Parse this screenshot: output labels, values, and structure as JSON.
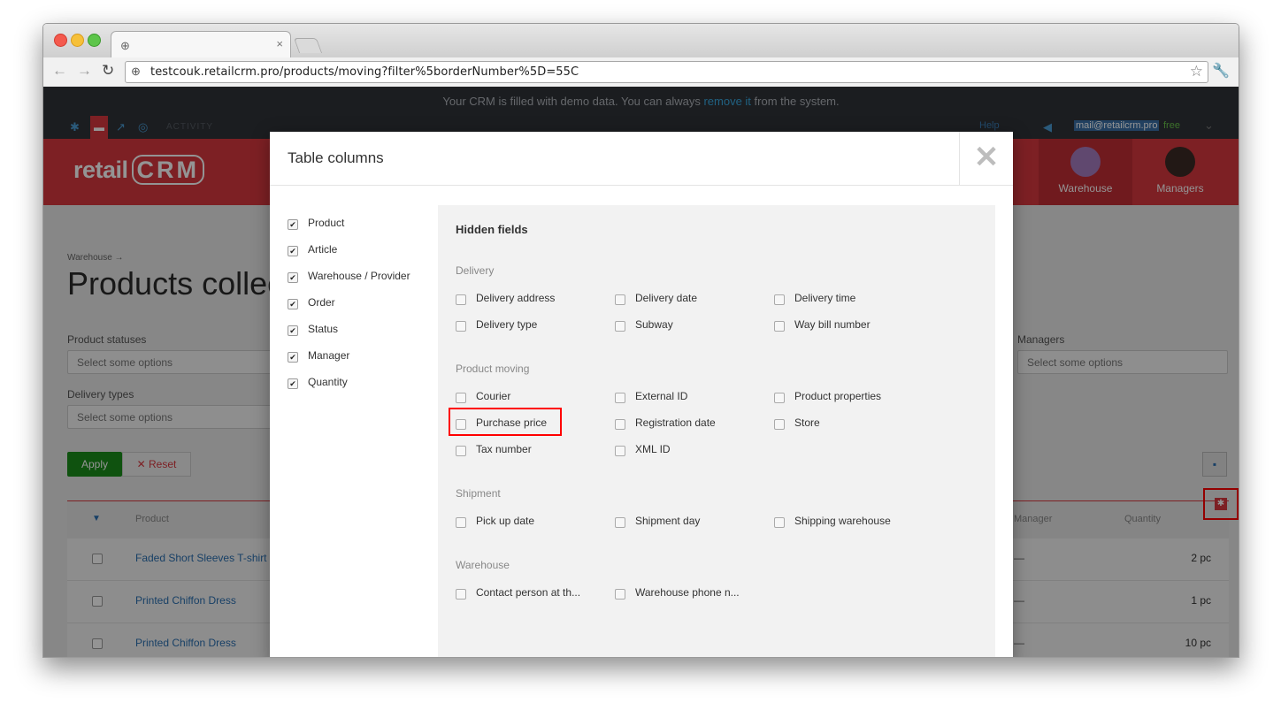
{
  "browser": {
    "tab_close": "×",
    "url": "testcouk.retailcrm.pro/products/moving?filter%5borderNumber%5D=55C"
  },
  "demo_banner": {
    "before": "Your CRM is filled with demo data. You can always ",
    "link": "remove it",
    "after": " from the system."
  },
  "topbar": {
    "activity": "ACTIVITY",
    "help": "Help",
    "email": "mail@retailcrm.pro",
    "plan": "free"
  },
  "header": {
    "logo_left": "retail",
    "logo_right": "CRM",
    "nav": [
      {
        "label": "Warehouse"
      },
      {
        "label": "Managers"
      }
    ]
  },
  "page": {
    "breadcrumb": "Warehouse →",
    "title": "Products collection",
    "filters": {
      "product_statuses_label": "Product statuses",
      "product_statuses_placeholder": "Select some options",
      "delivery_types_label": "Delivery types",
      "delivery_types_placeholder": "Select some options",
      "managers_label": "Managers",
      "managers_placeholder": "Select some options"
    },
    "apply_label": "Apply",
    "reset_label": "Reset",
    "table": {
      "headers": {
        "product": "Product",
        "manager": "Manager",
        "quantity": "Quantity"
      },
      "rows": [
        {
          "product": "Faded Short Sleeves T-shirt",
          "manager": "—",
          "quantity": "2 pc"
        },
        {
          "product": "Printed Chiffon Dress",
          "manager": "—",
          "quantity": "1 pc"
        },
        {
          "product": "Printed Chiffon Dress",
          "manager": "—",
          "quantity": "10 pc"
        }
      ]
    }
  },
  "modal": {
    "title": "Table columns",
    "visible_columns": [
      {
        "label": "Product",
        "checked": true
      },
      {
        "label": "Article",
        "checked": true
      },
      {
        "label": "Warehouse / Provider",
        "checked": true
      },
      {
        "label": "Order",
        "checked": true
      },
      {
        "label": "Status",
        "checked": true
      },
      {
        "label": "Manager",
        "checked": true
      },
      {
        "label": "Quantity",
        "checked": true
      }
    ],
    "hidden_title": "Hidden fields",
    "groups": [
      {
        "name": "Delivery",
        "fields": [
          "Delivery address",
          "Delivery date",
          "Delivery time",
          "Delivery type",
          "Subway",
          "Way bill number"
        ]
      },
      {
        "name": "Product moving",
        "fields": [
          "Courier",
          "External ID",
          "Product properties",
          "Purchase price",
          "Registration date",
          "Store",
          "Tax number",
          "XML ID"
        ]
      },
      {
        "name": "Shipment",
        "fields": [
          "Pick up date",
          "Shipment day",
          "Shipping warehouse"
        ]
      },
      {
        "name": "Warehouse",
        "fields": [
          "Contact person at th...",
          "Warehouse phone n..."
        ]
      }
    ]
  },
  "colors": {
    "brand_red": "#d7373f",
    "link_blue": "#2a6fb0",
    "apply_green": "#1a8d1a",
    "highlight": "#ff0000"
  }
}
